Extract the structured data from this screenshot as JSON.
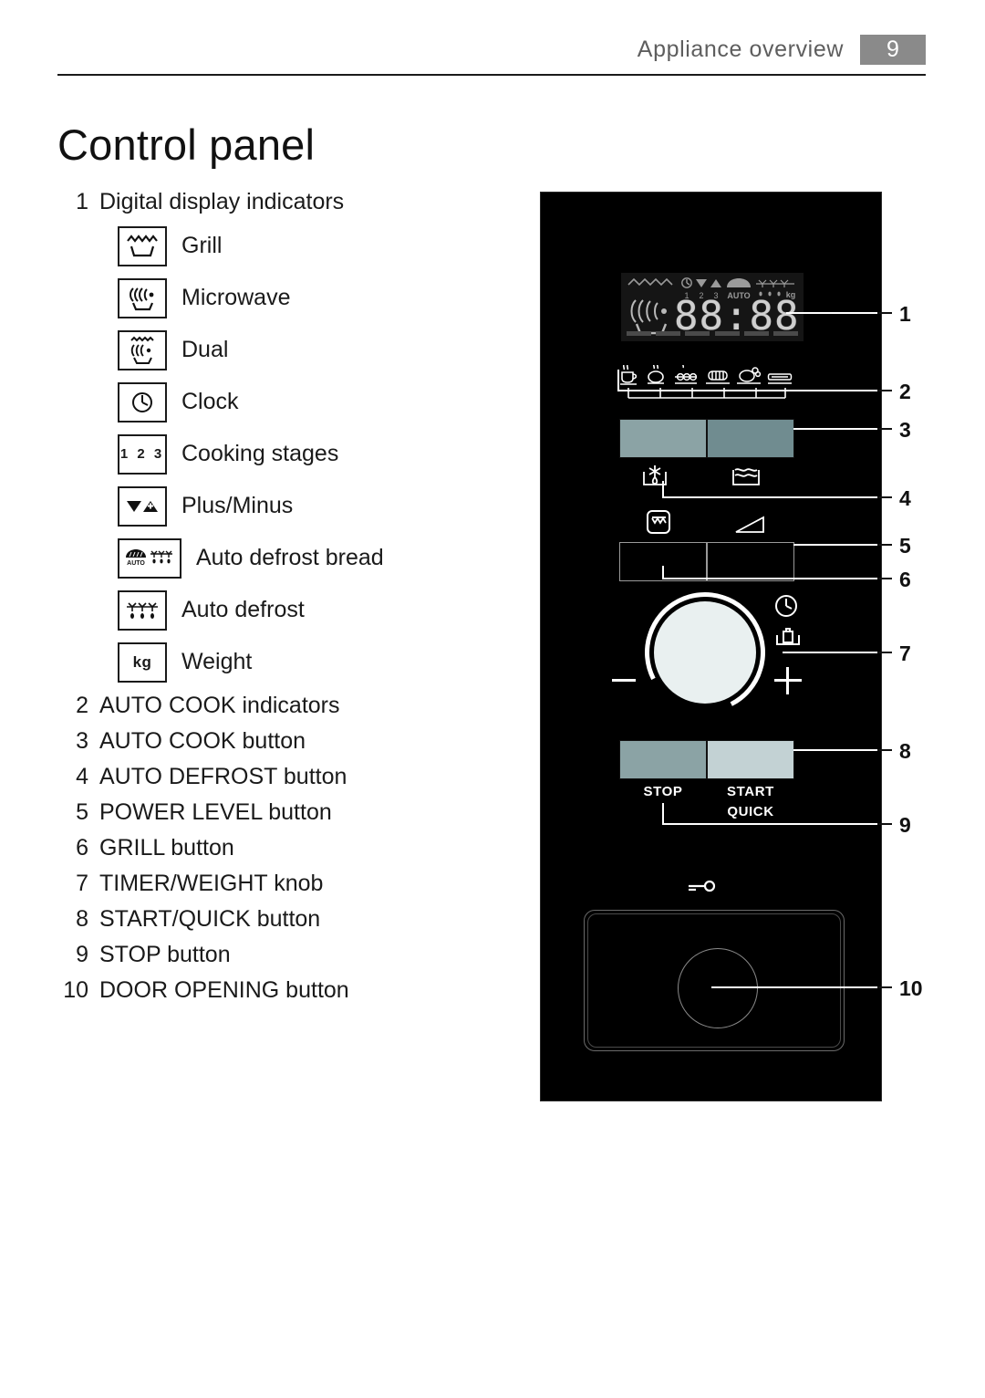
{
  "header": {
    "title": "Appliance overview",
    "page_number": "9"
  },
  "chapter_title": "Control panel",
  "list": {
    "item1": {
      "num": "1",
      "text": "Digital display indicators"
    },
    "indicators": [
      {
        "icon": "grill-icon",
        "label": "Grill"
      },
      {
        "icon": "microwave-icon",
        "label": "Microwave"
      },
      {
        "icon": "dual-icon",
        "label": "Dual"
      },
      {
        "icon": "clock-icon",
        "label": "Clock"
      },
      {
        "icon": "cooking-stages-icon",
        "label": "Cooking stages",
        "glyph": "1 2 3"
      },
      {
        "icon": "plus-minus-icon",
        "label": "Plus/Minus"
      },
      {
        "icon": "auto-defrost-bread-icon",
        "label": "Auto defrost bread",
        "glyph": "AUTO"
      },
      {
        "icon": "auto-defrost-icon",
        "label": "Auto defrost"
      },
      {
        "icon": "weight-icon",
        "label": "Weight",
        "glyph": "kg"
      }
    ],
    "items": [
      {
        "num": "2",
        "text": "AUTO COOK indicators"
      },
      {
        "num": "3",
        "text": "AUTO COOK button"
      },
      {
        "num": "4",
        "text": "AUTO DEFROST button"
      },
      {
        "num": "5",
        "text": "POWER LEVEL button"
      },
      {
        "num": "6",
        "text": "GRILL button"
      },
      {
        "num": "7",
        "text": "TIMER/WEIGHT knob"
      },
      {
        "num": "8",
        "text": "START/QUICK button"
      },
      {
        "num": "9",
        "text": "STOP button"
      },
      {
        "num": "10",
        "text": "DOOR OPENING button"
      }
    ]
  },
  "panel": {
    "display": {
      "digits": "88:88",
      "indicator_icons": [
        "grill-waves-icon",
        "microwave-waves-icon",
        "clock-icon",
        "minus-triangle-icon",
        "plus-triangle-icon",
        "stage-1",
        "stage-2",
        "stage-3",
        "bread-icon",
        "auto-label",
        "defrost-snowflakes-icon",
        "kg-label"
      ],
      "stage_labels": "1  2  3",
      "auto_label": "AUTO",
      "kg_label": "kg"
    },
    "autocook_indicator_icons": [
      "cup-icon",
      "potato-icon",
      "skewer-icon",
      "meat-icon",
      "chicken-icon",
      "fish-dish-icon"
    ],
    "buttons": {
      "autocook_left": "",
      "autocook_right": "",
      "defrost_icon": "defrost-snowflake-drop-icon",
      "autocook_icon": "pan-waves-icon",
      "grill_icon": "grill-button-icon",
      "power_icon": "power-level-wedge-icon",
      "grill_button": "",
      "power_button": "",
      "stop_label": "STOP",
      "start_label": "START",
      "quick_label": "QUICK"
    },
    "knob": {
      "minus": "−",
      "plus": "+",
      "clock_icon": "clock-icon",
      "weight_icon": "weight-pan-icon"
    },
    "door": {
      "key_icon": "key-icon"
    }
  },
  "callouts": [
    {
      "num": "1"
    },
    {
      "num": "2"
    },
    {
      "num": "3"
    },
    {
      "num": "4"
    },
    {
      "num": "5"
    },
    {
      "num": "6"
    },
    {
      "num": "7"
    },
    {
      "num": "8"
    },
    {
      "num": "9"
    },
    {
      "num": "10"
    }
  ],
  "colors": {
    "header_gray": "#8a8a8a",
    "panel_black": "#000000",
    "autocook_left": "#8ba3a5",
    "autocook_right": "#708c90",
    "stop_button": "#8ba3a5",
    "start_button": "#c3d2d4",
    "knob_face": "#e9f0f0"
  }
}
